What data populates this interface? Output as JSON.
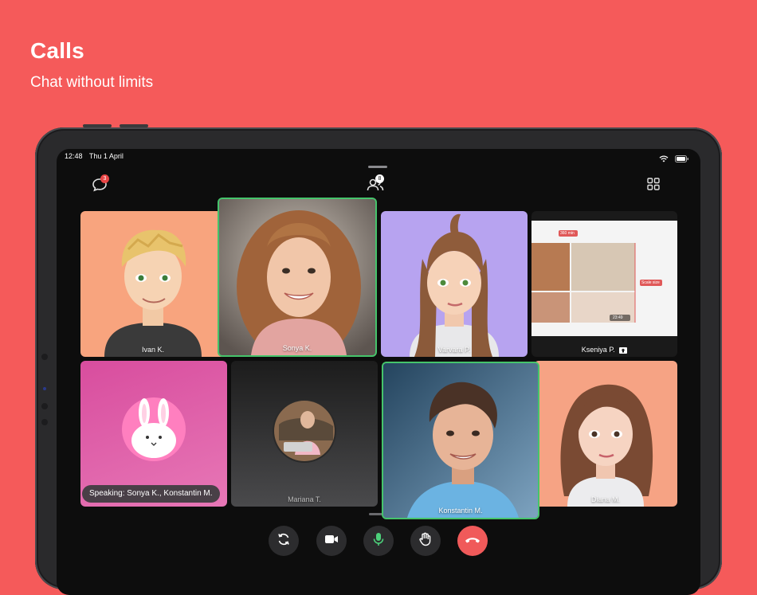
{
  "promo": {
    "title": "Calls",
    "subtitle": "Chat without limits"
  },
  "status": {
    "time": "12:48",
    "date": "Thu 1 April"
  },
  "toolbar": {
    "chat_badge": "3",
    "participants_badge": "8"
  },
  "participants": [
    {
      "name": "Ivan K."
    },
    {
      "name": "Sonya K."
    },
    {
      "name": "Varvara P."
    },
    {
      "name": "Kseniya P."
    },
    {
      "name": "Mariana T."
    },
    {
      "name": "Konstantin M."
    },
    {
      "name": "Diana M."
    }
  ],
  "screen_share": {
    "label_top": "360 min",
    "label_side": "Scale size",
    "timestamp": "23:49"
  },
  "speaking_indicator": "Speaking: Sonya K., Konstantin M.",
  "colors": {
    "background": "#f55a5a",
    "active_border": "#45c46b",
    "end_call": "#f05a5a",
    "badge": "#e84545"
  },
  "controls": [
    "switch-camera",
    "video",
    "microphone",
    "raise-hand",
    "end-call"
  ]
}
